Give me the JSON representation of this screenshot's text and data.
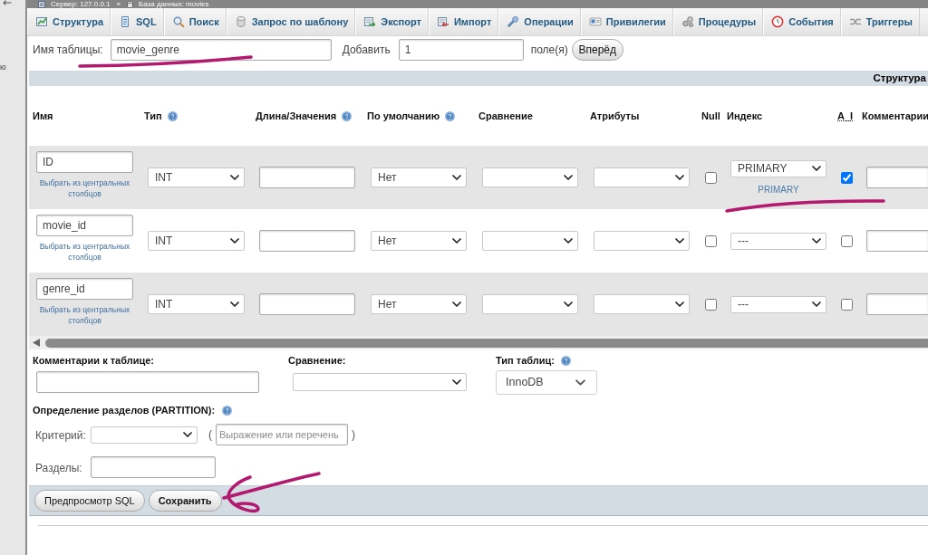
{
  "sidebar": {
    "items": [
      {
        "label": "ю"
      }
    ]
  },
  "breadcrumb": {
    "server": "Сервер: 127.0.0.1",
    "separator": "»",
    "database": "База данных: movies"
  },
  "tabs": [
    {
      "label": "Структура",
      "selected": false
    },
    {
      "label": "SQL",
      "selected": false
    },
    {
      "label": "Поиск",
      "selected": false
    },
    {
      "label": "Запрос по шаблону",
      "selected": false
    },
    {
      "label": "Экспорт",
      "selected": false
    },
    {
      "label": "Импорт",
      "selected": false
    },
    {
      "label": "Операции",
      "selected": false
    },
    {
      "label": "Привилегии",
      "selected": false
    },
    {
      "label": "Процедуры",
      "selected": false
    },
    {
      "label": "События",
      "selected": false
    },
    {
      "label": "Триггеры",
      "selected": false
    }
  ],
  "table_form": {
    "name_label": "Имя таблицы:",
    "name_value": "movie_genre",
    "add_label": "Добавить",
    "add_value": "1",
    "fields_label": "поле(я)",
    "go_button": "Вперёд"
  },
  "section_header": "Структура",
  "columns": [
    {
      "label": "Имя",
      "kind": "plain"
    },
    {
      "label": "Тип",
      "kind": "help"
    },
    {
      "label": "Длина/Значения",
      "kind": "help"
    },
    {
      "label": "По умолчанию",
      "kind": "help"
    },
    {
      "label": "Сравнение",
      "kind": "plain"
    },
    {
      "label": "Атрибуты",
      "kind": "plain"
    },
    {
      "label": "Null",
      "kind": "plain"
    },
    {
      "label": "Индекс",
      "kind": "plain"
    },
    {
      "label": "A_I",
      "kind": "abbr"
    },
    {
      "label": "Комментарии",
      "kind": "plain"
    }
  ],
  "fields": [
    {
      "name": "ID",
      "central_link": "Выбрать из центральных столбцов",
      "type": "INT",
      "default": "Нет",
      "null": false,
      "index": "PRIMARY",
      "index_link": "PRIMARY",
      "auto_increment": true
    },
    {
      "name": "movie_id",
      "central_link": "Выбрать из центральных столбцов",
      "type": "INT",
      "default": "Нет",
      "null": false,
      "index": "---",
      "auto_increment": false
    },
    {
      "name": "genre_id",
      "central_link": "Выбрать из центральных столбцов",
      "type": "INT",
      "default": "Нет",
      "null": false,
      "index": "---",
      "auto_increment": false
    }
  ],
  "table_options": {
    "comment_label": "Комментарии к таблице:",
    "collation_label": "Сравнение:",
    "engine_label": "Тип таблиц:",
    "engine": "InnoDB"
  },
  "partition": {
    "title": "Определение разделов (PARTITION):",
    "criterion_label": "Критерий:",
    "open_paren": "(",
    "expression_placeholder": "Выражение или перечень",
    "close_paren": ")",
    "partitions_label": "Разделы:"
  },
  "actions": [
    {
      "label": "Предпросмотр SQL",
      "primary": false
    },
    {
      "label": "Сохранить",
      "primary": true
    }
  ],
  "annotations": [
    {
      "kind": "underline"
    },
    {
      "kind": "underline"
    },
    {
      "kind": "arrow"
    }
  ]
}
